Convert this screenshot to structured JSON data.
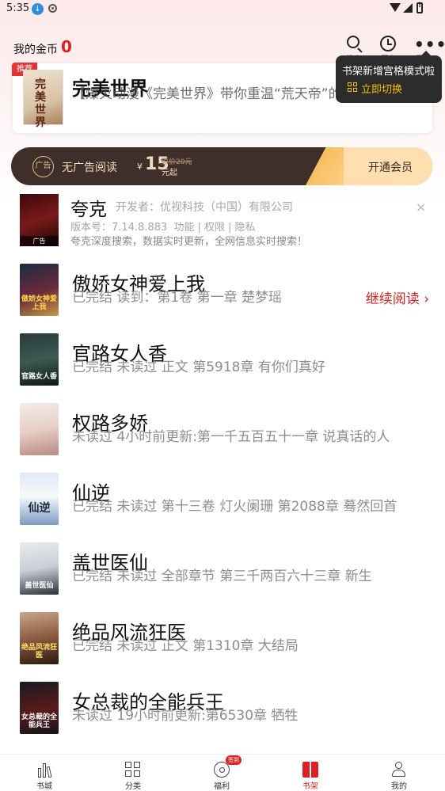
{
  "status_bar": {
    "time": "5:35"
  },
  "header": {
    "coin_label": "我的金币",
    "coin_value": "0",
    "search_label": "搜索",
    "history_label": "历史",
    "more_label": "更多"
  },
  "tooltip": {
    "text": "书架新增宫格模式啦",
    "action": "立即切换"
  },
  "recommend": {
    "badge": "推荐",
    "cover_text": "完美世界",
    "title": "完美世界",
    "description": "【爆火动漫《完美世界》带你重温“荒天帝”的一生】 ..."
  },
  "vip_banner": {
    "text": "无广告阅读",
    "currency": "¥",
    "price": "15",
    "original": "原价20元",
    "unit": "元起",
    "cta": "开通会员",
    "icon_text": "广告"
  },
  "ad": {
    "title": "夸克",
    "developer": "开发者：优视科技（中国）有限公司",
    "version": "版本号：7.14.8.883",
    "links": [
      "功能",
      "权限",
      "隐私"
    ],
    "description": "夸克深度搜索，数据实时更新，全网信息实时搜索！",
    "tag": "广告",
    "close": "×"
  },
  "books": [
    {
      "title": "傲娇女神爱上我",
      "status": "已完结 读到：第1卷 第一章 楚梦瑶",
      "cover_text": "傲娇女神爱上我",
      "continue": "继续阅读 ›"
    },
    {
      "title": "官路女人香",
      "status": "已完结 未读过 正文 第5918章 有你们真好",
      "cover_text": "官路女人香"
    },
    {
      "title": "权路多娇",
      "status": "未读过 4小时前更新:第一千五百五十一章 说真话的人",
      "cover_text": ""
    },
    {
      "title": "仙逆",
      "status": "已完结 未读过 第十三卷 灯火阑珊 第2088章 蓦然回首",
      "cover_text": "仙逆"
    },
    {
      "title": "盖世医仙",
      "status": "已完结 未读过 全部章节 第三千两百六十三章  新生",
      "cover_text": "盖世医仙"
    },
    {
      "title": "绝品风流狂医",
      "status": "已完结 未读过 正文 第1310章 大结局",
      "cover_text": "绝品风流狂医"
    },
    {
      "title": "女总裁的全能兵王",
      "status": "未读过 19小时前更新:第6530章 牺牲",
      "cover_text": "女总裁的全能兵王"
    }
  ],
  "bottom_nav": {
    "items": [
      {
        "label": "书城"
      },
      {
        "label": "分类"
      },
      {
        "label": "福利",
        "badge": "签到"
      },
      {
        "label": "书架"
      },
      {
        "label": "我的"
      }
    ]
  }
}
